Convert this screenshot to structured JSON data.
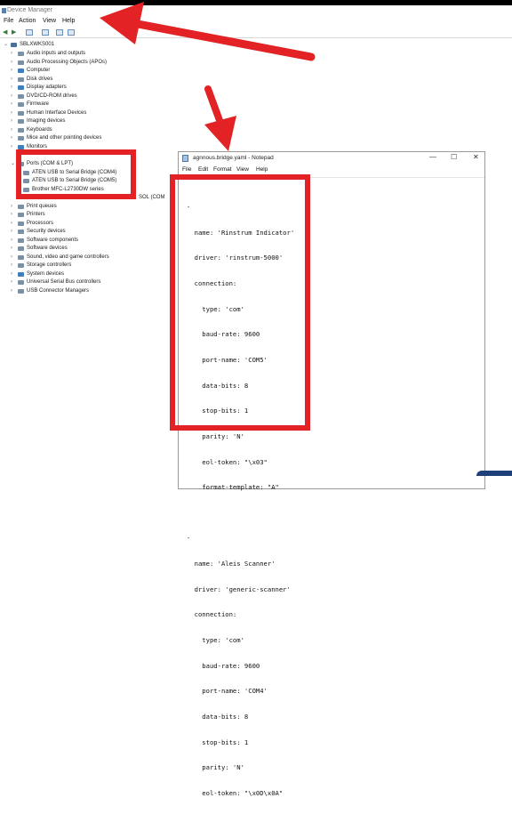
{
  "device_manager": {
    "title": "Device Manager",
    "menu": [
      "File",
      "Action",
      "View",
      "Help"
    ],
    "root": "SBLXWKS001",
    "items": [
      "Audio inputs and outputs",
      "Audio Processing Objects (APOs)",
      "Computer",
      "Disk drives",
      "Display adapters",
      "DVD/CD-ROM drives",
      "Firmware",
      "Human Interface Devices",
      "Imaging devices",
      "Keyboards",
      "Mice and other pointing devices",
      "Monitors"
    ],
    "ports_label": "Ports (COM & LPT)",
    "ports_children": [
      "ATEN USB to Serial Bridge (COM4)",
      "ATEN USB to Serial Bridge (COM5)",
      "Brother MFC-L2730DW series"
    ],
    "partial_item": "SOL (COM",
    "items_after": [
      "Print queues",
      "Printers",
      "Processors",
      "Security devices",
      "Software components",
      "Software devices",
      "Sound, video and game controllers",
      "Storage controllers",
      "System devices",
      "Universal Serial Bus controllers",
      "USB Connector Managers"
    ]
  },
  "notepad": {
    "title": "agnnous.bridge.yaml - Notepad",
    "menu": [
      "File",
      "Edit",
      "Format",
      "View",
      "Help"
    ],
    "lines": [
      "-",
      "  name: 'Rinstrum Indicator'",
      "  driver: 'rinstrum-5000'",
      "  connection:",
      "    type: 'com'",
      "    baud-rate: 9600",
      "    port-name: 'COM5'",
      "    data-bits: 8",
      "    stop-bits: 1",
      "    parity: 'N'",
      "    eol-token: \"\\x03\"",
      "    format-template: \"A\"",
      "",
      "-",
      "  name: 'Aleis Scanner'",
      "  driver: 'generic-scanner'",
      "  connection:",
      "    type: 'com'",
      "    baud-rate: 9600",
      "    port-name: 'COM4'",
      "    data-bits: 8",
      "    stop-bits: 1",
      "    parity: 'N'",
      "    eol-token: \"\\x0D\\x0A\""
    ],
    "window_buttons": [
      "—",
      "☐",
      "✕"
    ]
  },
  "colors": {
    "annotation_red": "#e22224",
    "taskbar_blue": "#1e3f7a"
  }
}
